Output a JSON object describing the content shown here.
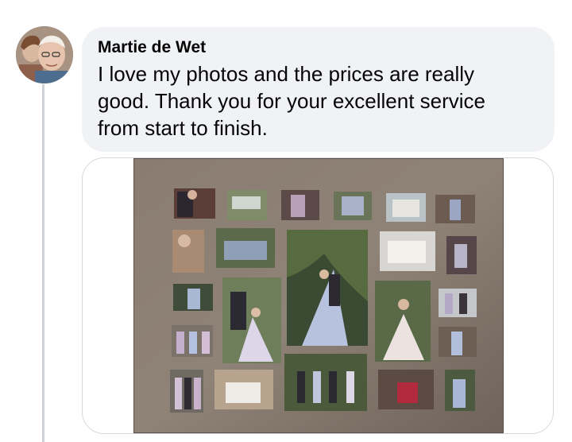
{
  "comment": {
    "author": "Martie de Wet",
    "text": "I love my photos and the prices are really good. Thank you for your excellent service from start to finish."
  },
  "attachment": {
    "type": "photo",
    "subject": "wall-of-framed-photos",
    "colors": {
      "wall": "#7a6d62",
      "canvas_shadow": "#3c342e"
    }
  },
  "avatar": {
    "icon": "profile-photo-icon"
  },
  "colors": {
    "bubble": "#f0f2f5",
    "thread_line": "#cfd3d8",
    "text": "#050505"
  }
}
